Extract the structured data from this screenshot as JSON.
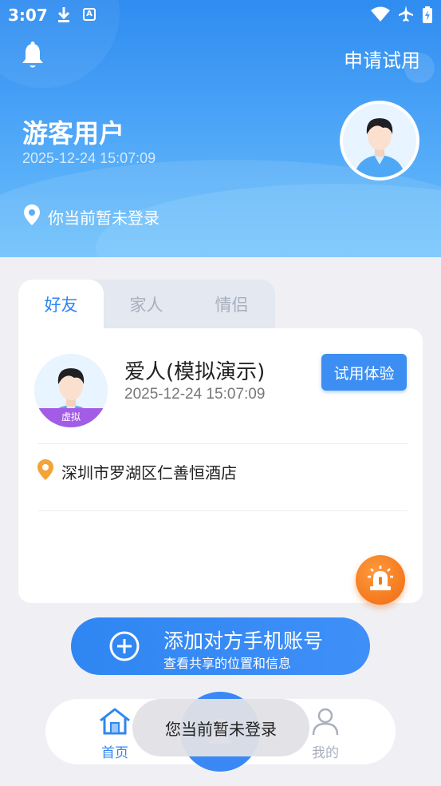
{
  "status_bar": {
    "time": "3:07",
    "icons": [
      "download-icon",
      "a-icon",
      "wifi-icon",
      "airplane-icon",
      "battery-charging-icon"
    ]
  },
  "header": {
    "apply_trial": "申请试用",
    "user_name": "游客用户",
    "timestamp": "2025-12-24 15:07:09",
    "login_status": "你当前暂未登录"
  },
  "tabs": [
    {
      "label": "好友",
      "active": true
    },
    {
      "label": "家人",
      "active": false
    },
    {
      "label": "情侣",
      "active": false
    }
  ],
  "friend_card": {
    "name": "爱人(模拟演示)",
    "timestamp": "2025-12-24 15:07:09",
    "trial_button": "试用体验",
    "virtual_badge": "虚拟",
    "address": "深圳市罗湖区仁善恒酒店"
  },
  "add_account": {
    "title": "添加对方手机账号",
    "subtitle": "查看共享的位置和信息"
  },
  "bottom_nav": {
    "home": "首页",
    "mine": "我的"
  },
  "toast": {
    "message": "您当前暂未登录"
  },
  "colors": {
    "primary": "#2f86f2",
    "alarm": "#f07a1a",
    "virtual": "#a35ce6"
  }
}
